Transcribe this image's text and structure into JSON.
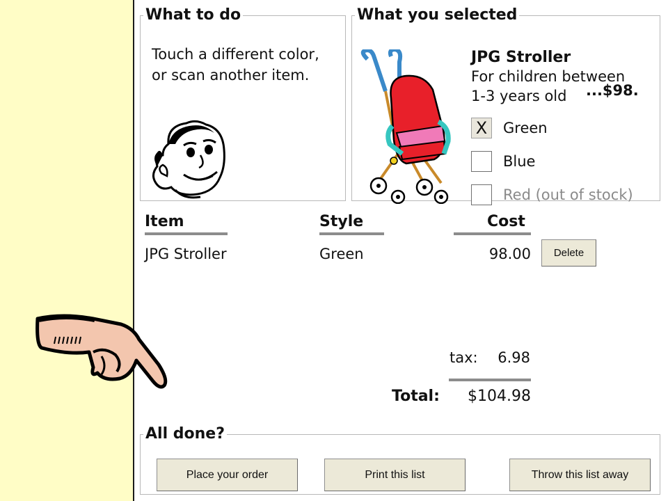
{
  "instructions": {
    "title": "What to do",
    "line1": "Touch a different color,",
    "line2": "or scan another item."
  },
  "selection": {
    "title": "What you selected",
    "product_name": "JPG Stroller",
    "desc_line1": "For children between",
    "desc_line2": "1-3 years old",
    "price": "...$98.",
    "options": [
      {
        "label": "Green",
        "checked": true,
        "mark": "X",
        "enabled": true
      },
      {
        "label": "Blue",
        "checked": false,
        "mark": "",
        "enabled": true
      },
      {
        "label": "Red (out of stock)",
        "checked": false,
        "mark": "",
        "enabled": false
      }
    ]
  },
  "cart": {
    "headers": {
      "item": "Item",
      "style": "Style",
      "cost": "Cost"
    },
    "rows": [
      {
        "item": "JPG Stroller",
        "style": "Green",
        "cost": "98.00",
        "action": "Delete"
      }
    ],
    "tax_label": "tax:",
    "tax_value": "6.98",
    "total_label": "Total:",
    "total_value": "$104.98"
  },
  "done": {
    "title": "All done?",
    "place_order": "Place your order",
    "print_list": "Print this list",
    "throw_away": "Throw this list away"
  },
  "colors": {
    "left_strip": "#fffdc6",
    "panel": "#ffffff",
    "button_face": "#ece9d8",
    "rule_gray": "#8c8c8c",
    "disabled_text": "#8a8a8a"
  },
  "icons": [
    "cartoon-face-icon",
    "stroller-image",
    "pointing-hand-icon"
  ]
}
